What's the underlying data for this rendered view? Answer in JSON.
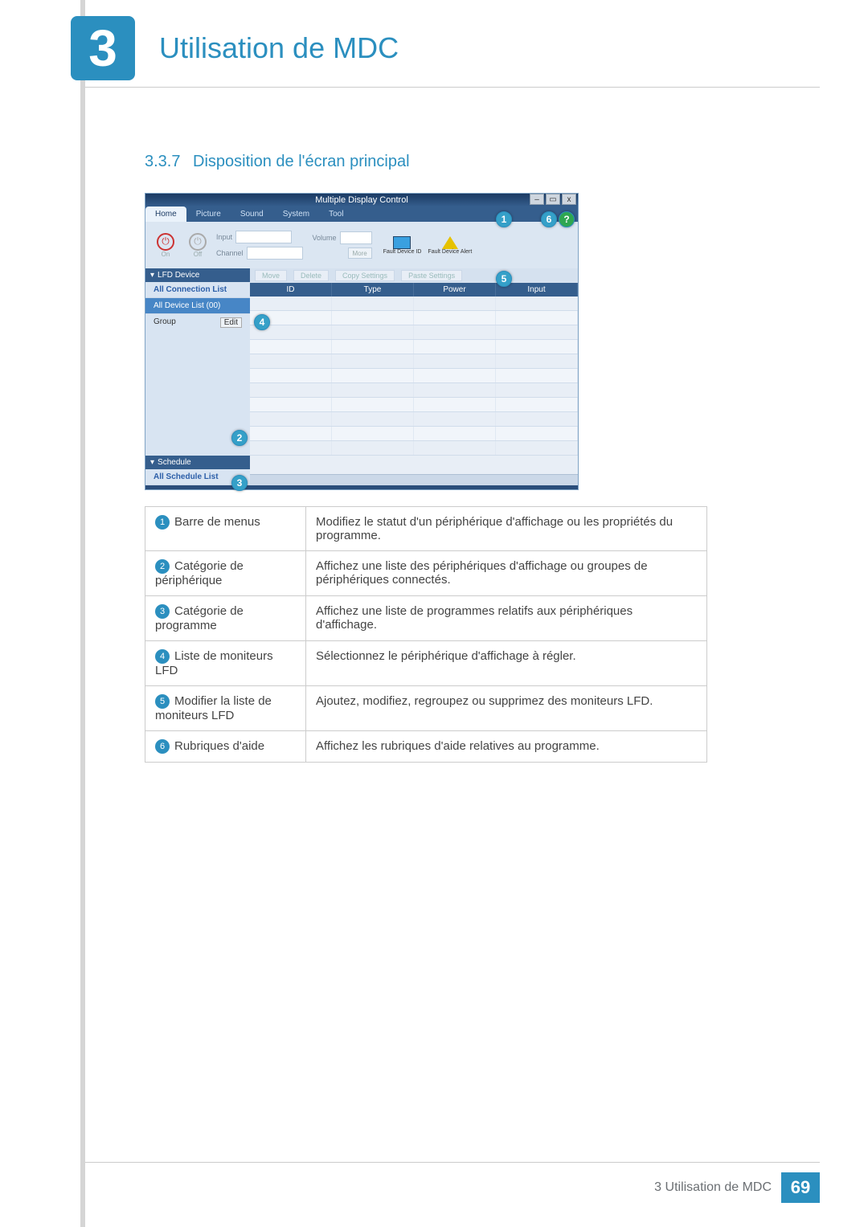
{
  "chapter": {
    "number": "3",
    "title": "Utilisation de MDC"
  },
  "section": {
    "number": "3.3.7",
    "title": "Disposition de l'écran principal"
  },
  "screenshot": {
    "window_title": "Multiple Display Control",
    "win_controls": {
      "minimize": "–",
      "maximize": "▭",
      "close": "x"
    },
    "tabs": [
      "Home",
      "Picture",
      "Sound",
      "System",
      "Tool"
    ],
    "active_tab": "Home",
    "power": {
      "on": "On",
      "off": "Off"
    },
    "toolbar": {
      "input_label": "Input",
      "channel_label": "Channel",
      "volume_label": "Volume",
      "more_label": "More"
    },
    "fault": {
      "id": "Fault Device ID",
      "alert": "Fault Device Alert"
    },
    "sidebar": {
      "lfd_header": "LFD Device",
      "all_connection": "All Connection List",
      "all_device": "All Device List (00)",
      "group_label": "Group",
      "edit_label": "Edit",
      "schedule_header": "Schedule",
      "all_schedule": "All Schedule List"
    },
    "ops": {
      "move": "Move",
      "delete": "Delete",
      "copy": "Copy Settings",
      "paste": "Paste Settings"
    },
    "grid_headers": [
      "ID",
      "Type",
      "Power",
      "Input"
    ]
  },
  "markers": {
    "m1": "1",
    "m2": "2",
    "m3": "3",
    "m4": "4",
    "m5": "5",
    "m6": "6",
    "help": "?"
  },
  "legend": [
    {
      "num": "1",
      "label": "Barre de menus",
      "desc": "Modifiez le statut d'un périphérique d'affichage ou les propriétés du programme."
    },
    {
      "num": "2",
      "label": "Catégorie de périphérique",
      "desc": "Affichez une liste des périphériques d'affichage ou groupes de périphériques connectés."
    },
    {
      "num": "3",
      "label": "Catégorie de programme",
      "desc": "Affichez une liste de programmes relatifs aux périphériques d'affichage."
    },
    {
      "num": "4",
      "label": "Liste de moniteurs LFD",
      "desc": "Sélectionnez le périphérique d'affichage à régler."
    },
    {
      "num": "5",
      "label": "Modifier la liste de moniteurs LFD",
      "desc": "Ajoutez, modifiez, regroupez ou supprimez des moniteurs LFD."
    },
    {
      "num": "6",
      "label": "Rubriques d'aide",
      "desc": "Affichez les rubriques d'aide relatives au programme."
    }
  ],
  "footer": {
    "chapter_ref": "3 Utilisation de MDC",
    "page": "69"
  }
}
